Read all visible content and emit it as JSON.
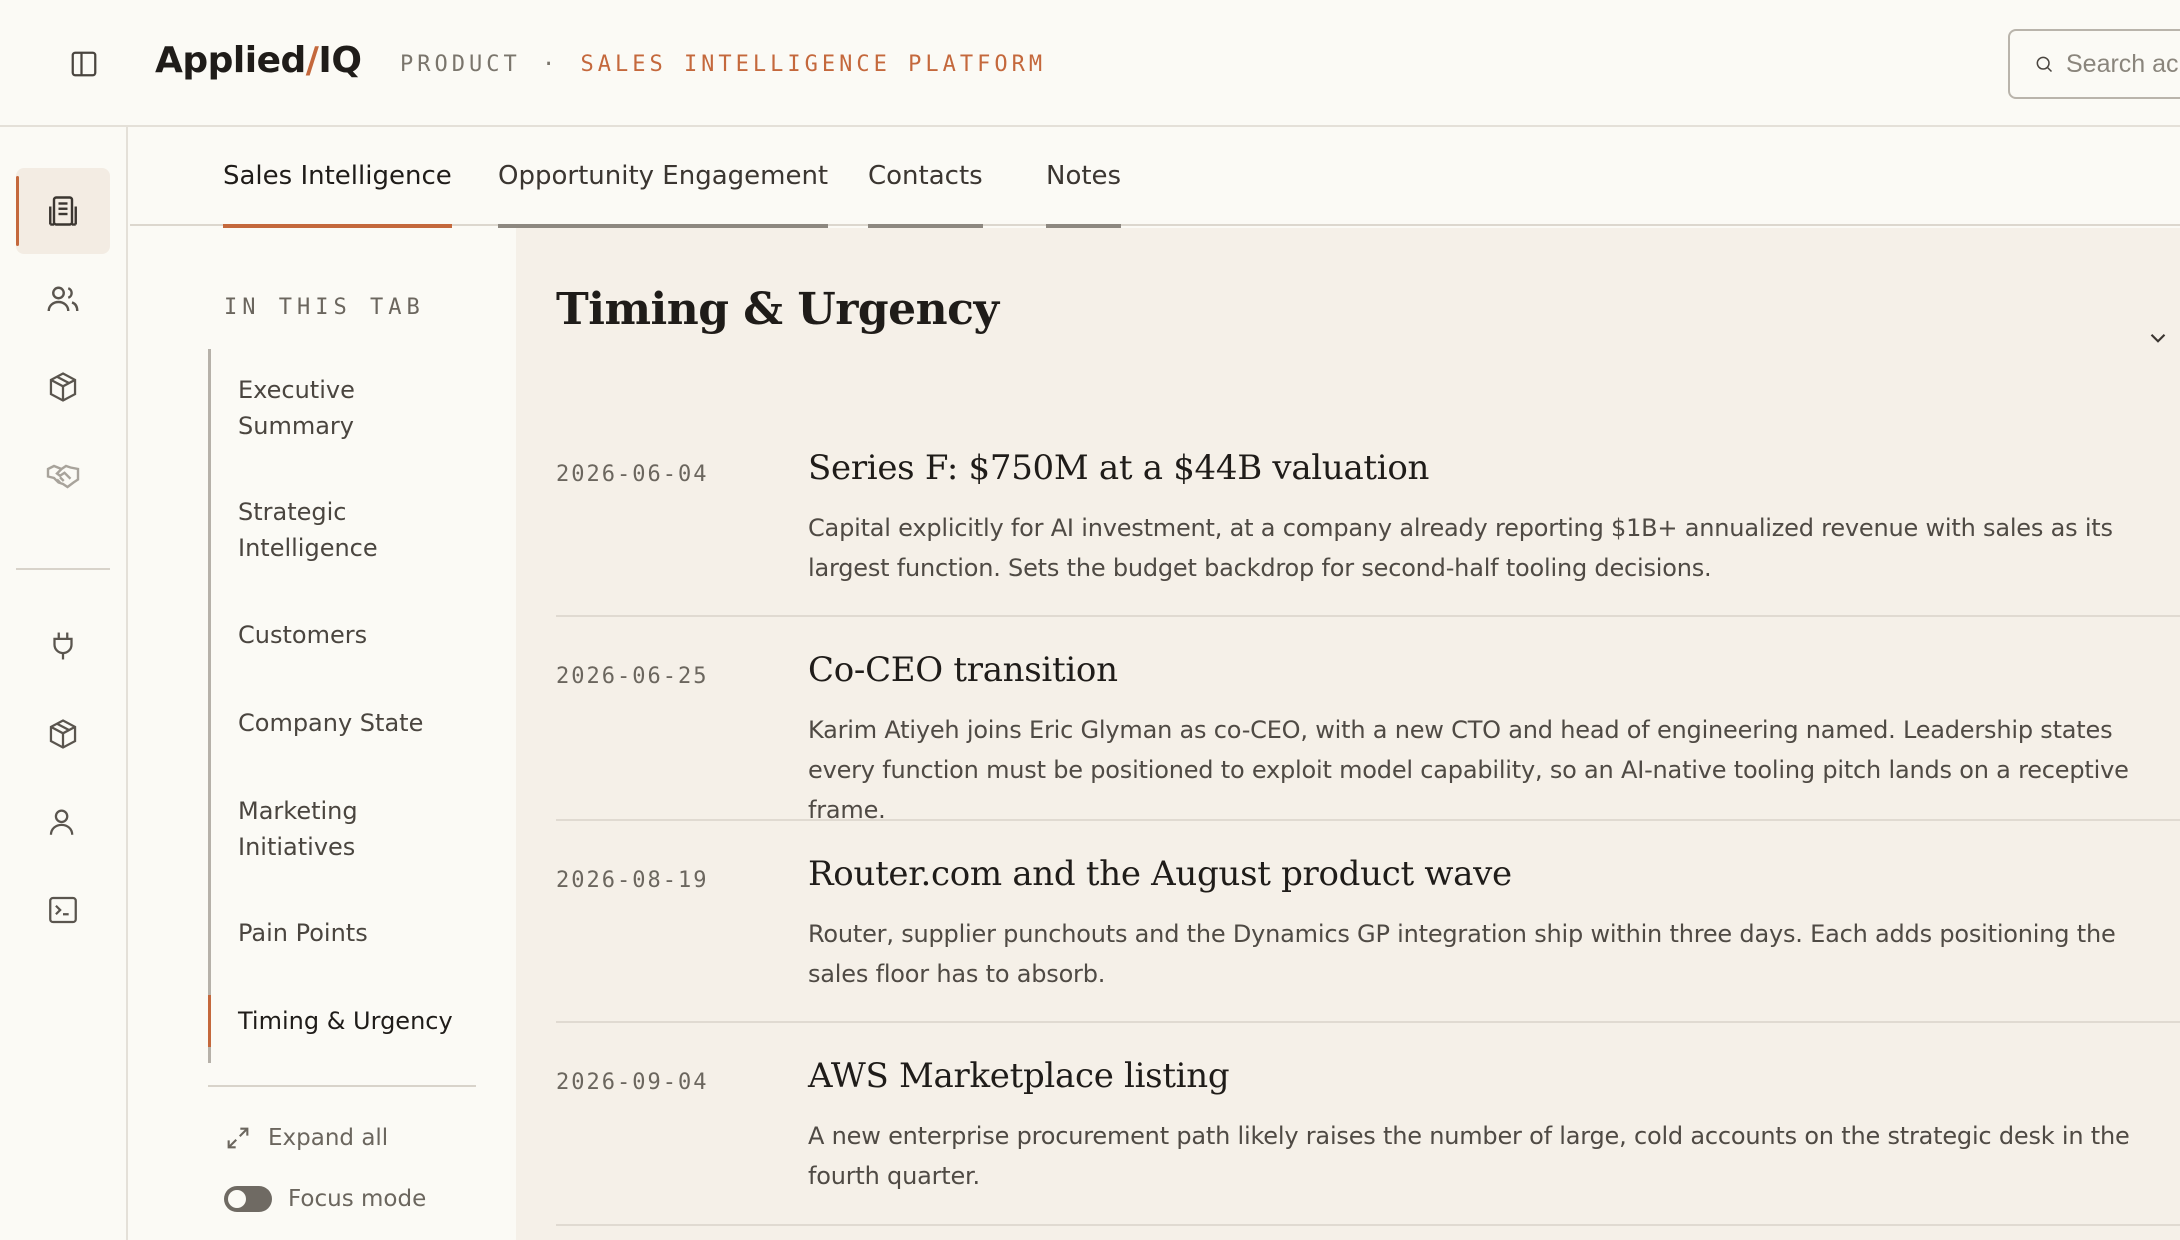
{
  "app": {
    "logo_left": "Applied",
    "logo_slash": "/",
    "logo_right": "IQ",
    "crumb_section": "PRODUCT",
    "crumb_dot": "·",
    "crumb_page": "SALES INTELLIGENCE PLATFORM",
    "search_placeholder": "Search ac"
  },
  "rail": {
    "items": [
      {
        "icon": "document-icon",
        "active": true
      },
      {
        "icon": "users-icon",
        "active": false
      },
      {
        "icon": "box-icon",
        "active": false
      },
      {
        "icon": "handshake-icon",
        "active": false
      },
      {
        "icon": "plug-icon",
        "active": false
      },
      {
        "icon": "box-icon",
        "active": false
      },
      {
        "icon": "user-icon",
        "active": false
      },
      {
        "icon": "terminal-icon",
        "active": false
      }
    ]
  },
  "tabs": [
    {
      "label": "Sales Intelligence",
      "active": true
    },
    {
      "label": "Opportunity Engagement",
      "active": false
    },
    {
      "label": "Contacts",
      "active": false
    },
    {
      "label": "Notes",
      "active": false
    }
  ],
  "toc": {
    "title": "IN THIS TAB",
    "items": [
      {
        "label": "Executive Summary",
        "active": false
      },
      {
        "label": "Strategic Intelligence",
        "active": false
      },
      {
        "label": "Customers",
        "active": false
      },
      {
        "label": "Company State",
        "active": false
      },
      {
        "label": "Marketing Initiatives",
        "active": false
      },
      {
        "label": "Pain Points",
        "active": false
      },
      {
        "label": "Timing & Urgency",
        "active": true
      }
    ],
    "expand_all": "Expand all",
    "focus_mode": "Focus mode",
    "focus_mode_on": false
  },
  "section": {
    "title": "Timing & Urgency",
    "entries": [
      {
        "date": "2026-06-04",
        "title": "Series F: $750M at a $44B valuation",
        "body": "Capital explicitly for AI investment, at a company already reporting $1B+ annualized revenue with sales as its largest function. Sets the budget backdrop for second-half tooling decisions."
      },
      {
        "date": "2026-06-25",
        "title": "Co-CEO transition",
        "body": "Karim Atiyeh joins Eric Glyman as co-CEO, with a new CTO and head of engineering named. Leadership states every function must be positioned to exploit model capability, so an AI-native tooling pitch lands on a receptive frame."
      },
      {
        "date": "2026-08-19",
        "title": "Router.com and the August product wave",
        "body": "Router, supplier punchouts and the Dynamics GP integration ship within three days. Each adds positioning the sales floor has to absorb."
      },
      {
        "date": "2026-09-04",
        "title": "AWS Marketplace listing",
        "body": "A new enterprise procurement path likely raises the number of large, cold accounts on the strategic desk in the fourth quarter."
      }
    ]
  },
  "colors": {
    "accent": "#c4683c",
    "panel_bg": "#f5f0e8",
    "page_bg": "#fbfaf5"
  }
}
